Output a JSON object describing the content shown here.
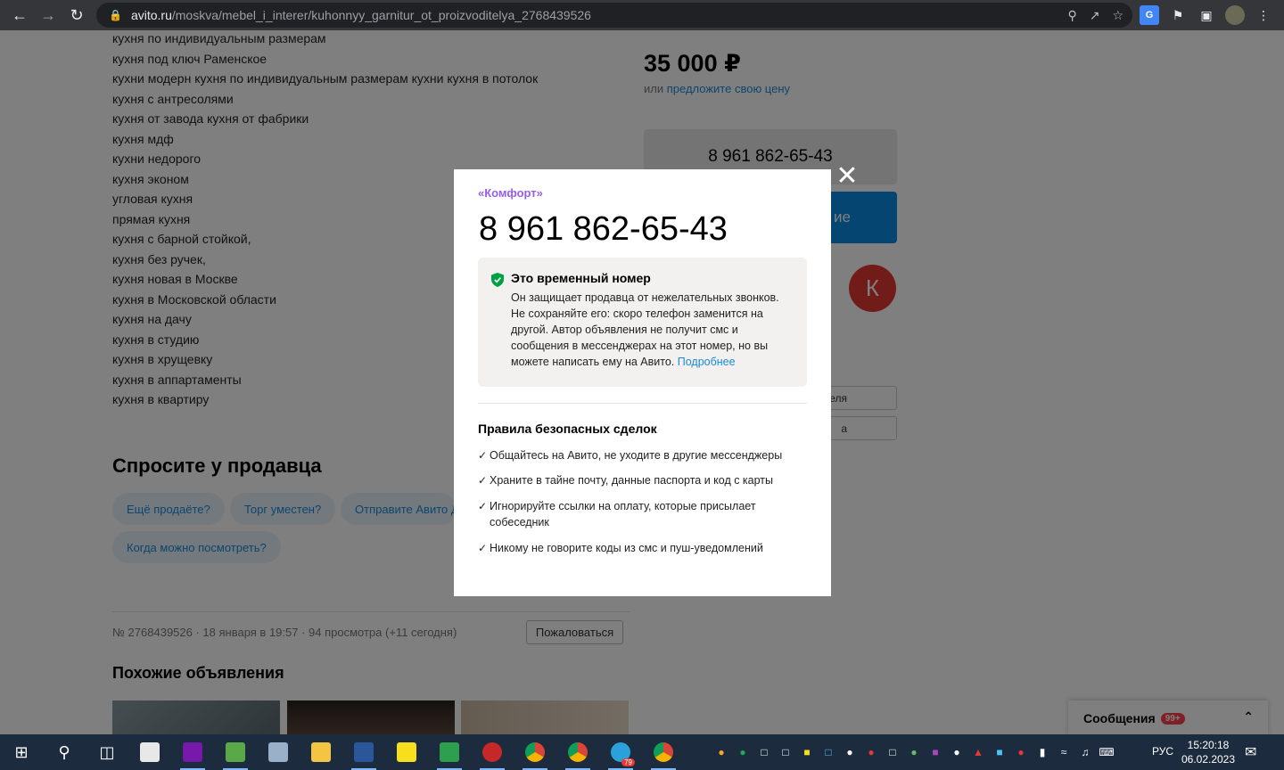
{
  "browser": {
    "url_host": "avito.ru",
    "url_path": "/moskva/mebel_i_interer/kuhonnyy_garnitur_ot_proizvoditelya_2768439526"
  },
  "keywords": [
    "кухня по индивидуальным размерам",
    "кухня под ключ Раменское",
    "кухни модерн кухня по индивидуальным размерам кухни кухня в потолок",
    "кухня с антресолями",
    "кухня от завода кухня от фабрики",
    "кухня мдф",
    "кухни недорого",
    "кухня эконом",
    "угловая кухня",
    "прямая кухня",
    "кухня с барной стойкой,",
    "кухня без ручек,",
    "кухня новая в Москве",
    "кухня в Московской области",
    "кухня на дачу",
    "кухня в студию",
    "кухня в хрущевку",
    "кухня в аппартаменты",
    "кухня в квартиру"
  ],
  "ask": {
    "title": "Спросите у продавца",
    "chips": [
      "Ещё продаёте?",
      "Торг уместен?",
      "Отправите Авито Д",
      "Когда можно посмотреть?"
    ]
  },
  "listing_meta": "№ 2768439526 · 18 января в 19:57 · 94 просмотра (+11 сегодня)",
  "complain_label": "Пожаловаться",
  "similar_title": "Похожие объявления",
  "sidebar": {
    "price": "35 000 ₽",
    "offer_prefix": "или",
    "offer_link": "предложите свою цену",
    "phone": "8 961 862-65-43",
    "message_btn_partial": "ие",
    "avatar_letter": "К",
    "box1": "еля",
    "box2": "а"
  },
  "messages_panel": {
    "label": "Сообщения",
    "badge": "99+"
  },
  "modal": {
    "seller": "«Комфорт»",
    "phone": "8 961 862-65-43",
    "notice_title": "Это временный номер",
    "notice_body": "Он защищает продавца от нежелательных звонков. Не сохраняйте его: скоро телефон заменится на другой. Автор объявления не получит смс и сообщения в мессенджерах на этот номер, но вы можете написать ему на Авито.",
    "notice_link": "Подробнее",
    "rules_title": "Правила безопасных сделок",
    "rules": [
      "Общайтесь на Авито, не уходите в другие мессенджеры",
      "Храните в тайне почту, данные паспорта и код с карты",
      "Игнорируйте ссылки на оплату, которые присылает собеседник",
      "Никому не говорите коды из смс и пуш-уведомлений"
    ]
  },
  "taskbar": {
    "lang": "РУС",
    "time": "15:20:18",
    "date": "06.02.2023",
    "telegram_badge": "79"
  },
  "colors": {
    "avito_blue": "#0a8ae5",
    "link_blue": "#1a8ad9",
    "seller_purple": "#965eeb",
    "avatar_red": "#e53935"
  }
}
